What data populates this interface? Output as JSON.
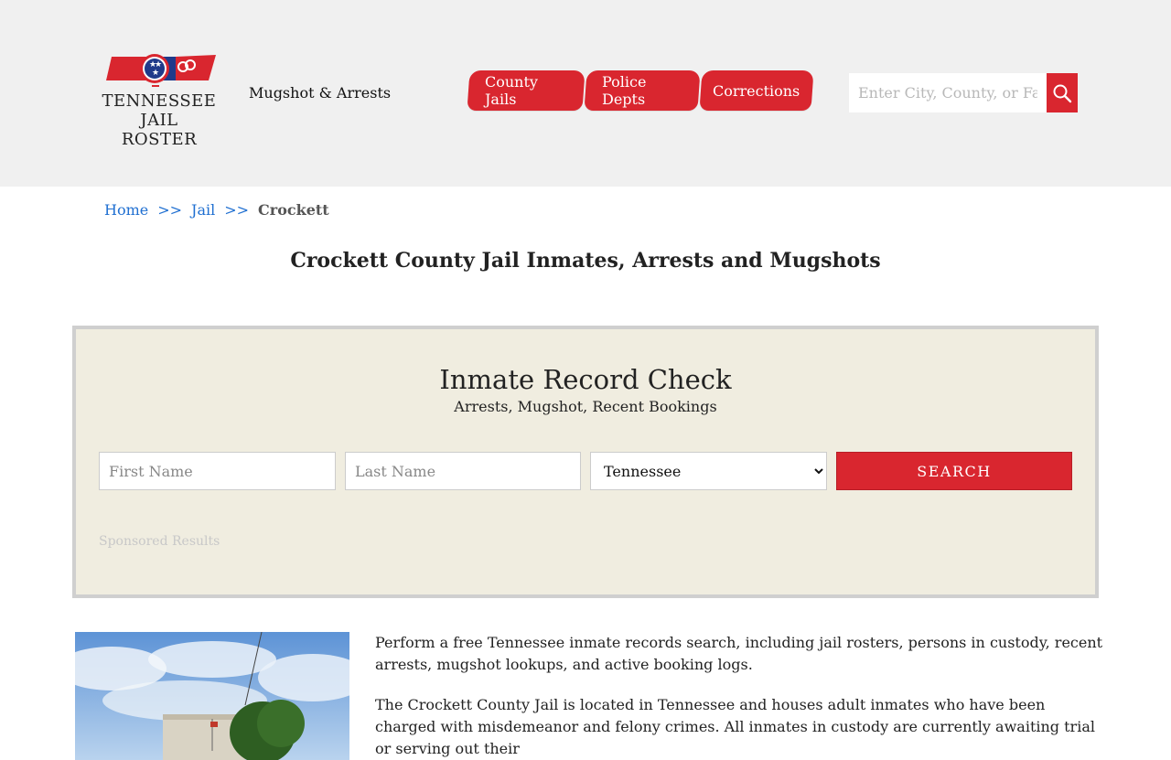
{
  "header": {
    "logo": {
      "line1": "TENNESSEE",
      "line2": "JAIL ROSTER"
    },
    "tagline": "Mugshot & Arrests",
    "nav": [
      "County Jails",
      "Police Depts",
      "Corrections"
    ],
    "search_placeholder": "Enter City, County, or Facility",
    "search_icon": "magnifier-icon",
    "colors": {
      "brand_red": "#d9262f",
      "header_bg": "#f0f0f0"
    }
  },
  "breadcrumb": {
    "home": "Home",
    "sep": ">>",
    "jail": "Jail",
    "current": "Crockett"
  },
  "page_title": "Crockett County Jail Inmates, Arrests and Mugshots",
  "record_check": {
    "title": "Inmate Record Check",
    "subtitle": "Arrests, Mugshot, Recent Bookings",
    "first_name_placeholder": "First Name",
    "last_name_placeholder": "Last Name",
    "state_selected": "Tennessee",
    "search_label": "SEARCH",
    "sponsored": "Sponsored Results",
    "colors": {
      "panel_bg": "#f0ede0",
      "panel_border": "#cfcfcf"
    }
  },
  "content": {
    "paragraph1": "Perform a free Tennessee inmate records search, including jail rosters, persons in custody, recent arrests, mugshot lookups, and active booking logs.",
    "paragraph2": "The Crockett County Jail is located in Tennessee and houses adult inmates who have been charged with misdemeanor and felony crimes. All inmates in custody are currently awaiting trial or serving out their"
  }
}
